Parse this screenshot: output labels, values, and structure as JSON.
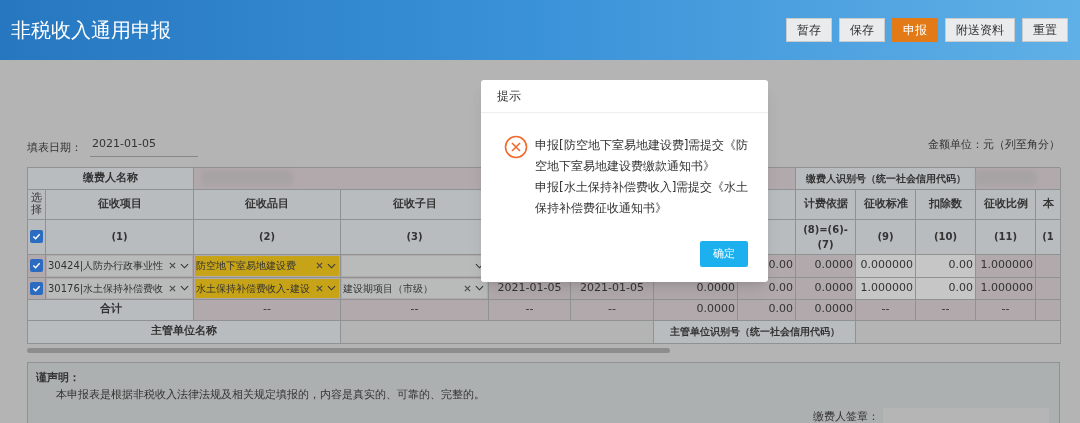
{
  "header": {
    "title": "非税收入通用申报",
    "buttons": [
      {
        "label": "暂存",
        "selected": false
      },
      {
        "label": "保存",
        "selected": false
      },
      {
        "label": "申报",
        "selected": true
      },
      {
        "label": "附送资料",
        "selected": false
      },
      {
        "label": "重置",
        "selected": false
      }
    ]
  },
  "form": {
    "date_label": "填表日期：",
    "date_value": "2021-01-05",
    "unit_note": "金额单位：元（列至角分）"
  },
  "table": {
    "payer_name_label": "缴费人名称",
    "payer_id_label": "缴费人识别号（统一社会信用代码）",
    "select_header": "选择",
    "all_checked": true,
    "columns": [
      {
        "title": "征收项目",
        "number": "(1)"
      },
      {
        "title": "征收品目",
        "number": "(2)"
      },
      {
        "title": "征收子目",
        "number": "(3)"
      },
      {},
      {},
      {},
      {},
      {
        "title": "计费依据",
        "number": "(8)=(6)-(7)"
      },
      {
        "title": "征收标准",
        "number": "(9)"
      },
      {
        "title": "扣除数",
        "number": "(10)"
      },
      {
        "title": "征收比例",
        "number": "(11)"
      },
      {
        "title": "本",
        "number": "(1"
      }
    ],
    "rows": [
      {
        "checked": true,
        "cells": [
          {
            "kind": "select",
            "value": "30424|人防办行政事业性",
            "clearable": true,
            "highlight": false
          },
          {
            "kind": "select",
            "value": "防空地下室易地建设费",
            "clearable": true,
            "highlight": true
          },
          {
            "kind": "select",
            "clearable": false,
            "highlight": false
          },
          {
            "kind": "hidden"
          },
          {
            "kind": "hidden"
          },
          {
            "kind": "hidden"
          },
          {
            "kind": "number",
            "value": "0.00",
            "editable": false
          },
          {
            "kind": "number",
            "value": "0.0000",
            "editable": false
          },
          {
            "kind": "number",
            "value": "0.000000",
            "editable": true
          },
          {
            "kind": "number",
            "value": "0.00",
            "editable": true
          },
          {
            "kind": "number",
            "value": "1.000000",
            "editable": false
          },
          {
            "kind": "hidden"
          }
        ]
      },
      {
        "checked": true,
        "cells": [
          {
            "kind": "select",
            "value": "30176|水土保持补偿费收",
            "clearable": true,
            "highlight": false
          },
          {
            "kind": "select",
            "value": "水土保持补偿费收入-建设",
            "clearable": true,
            "highlight": true
          },
          {
            "kind": "select",
            "value": "建设期项目（市级）",
            "clearable": true,
            "highlight": false
          },
          {
            "kind": "date",
            "value": "2021-01-05"
          },
          {
            "kind": "date",
            "value": "2021-01-05"
          },
          {
            "kind": "number",
            "value": "0.0000",
            "editable": false
          },
          {
            "kind": "number",
            "value": "0.00",
            "editable": false
          },
          {
            "kind": "number",
            "value": "0.0000",
            "editable": false
          },
          {
            "kind": "number",
            "value": "1.000000",
            "editable": true
          },
          {
            "kind": "number",
            "value": "0.00",
            "editable": true
          },
          {
            "kind": "number",
            "value": "1.000000",
            "editable": false
          },
          {
            "kind": "hidden"
          }
        ]
      }
    ],
    "total": {
      "label": "合计",
      "cells": [
        "--",
        "--",
        "--",
        "--",
        "0.0000",
        "0.00",
        "0.0000",
        "--",
        "--",
        "--"
      ]
    },
    "authority_name_label": "主管单位名称",
    "authority_id_label": "主管单位识别号（统一社会信用代码）"
  },
  "declaration": {
    "heading": "谨声明：",
    "text": "本申报表是根据非税收入法律法规及相关规定填报的，内容是真实的、可靠的、完整的。",
    "signature_label": "缴费人签章："
  },
  "dialog": {
    "title": "提示",
    "messages": [
      "申报[防空地下室易地建设费]需提交《防空地下室易地建设费缴款通知书》",
      "申报[水土保持补偿费收入]需提交《水土保持补偿费征收通知书》"
    ],
    "confirm": "确定"
  }
}
